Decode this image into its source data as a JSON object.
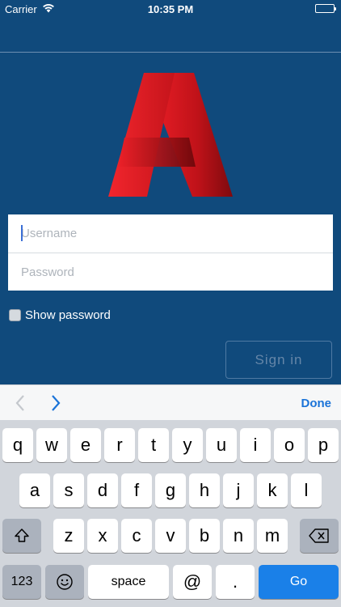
{
  "status": {
    "carrier": "Carrier",
    "time": "10:35 PM"
  },
  "colors": {
    "background": "#104a7c",
    "logo_red": "#e31d24",
    "logo_dark_red": "#8e0c10",
    "accent_blue": "#1a80e8"
  },
  "login": {
    "username_placeholder": "Username",
    "password_placeholder": "Password",
    "show_password_label": "Show password",
    "signin_label": "Sign in"
  },
  "accessory": {
    "done_label": "Done"
  },
  "keyboard": {
    "row1": [
      "q",
      "w",
      "e",
      "r",
      "t",
      "y",
      "u",
      "i",
      "o",
      "p"
    ],
    "row2": [
      "a",
      "s",
      "d",
      "f",
      "g",
      "h",
      "j",
      "k",
      "l"
    ],
    "row3": [
      "z",
      "x",
      "c",
      "v",
      "b",
      "n",
      "m"
    ],
    "numbers_label": "123",
    "space_label": "space",
    "at_label": "@",
    "period_label": ".",
    "go_label": "Go"
  }
}
